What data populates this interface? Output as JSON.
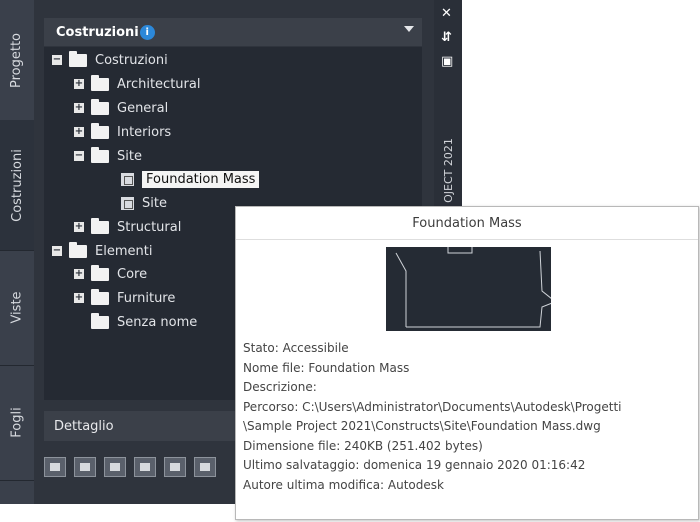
{
  "tabs": {
    "progetto": "Progetto",
    "costruzioni": "Costruzioni",
    "viste": "Viste",
    "fogli": "Fogli"
  },
  "header": {
    "title": "Costruzioni",
    "info": "i"
  },
  "tree": [
    {
      "label": "Costruzioni",
      "expander": "−"
    },
    {
      "label": "Architectural",
      "expander": "+"
    },
    {
      "label": "General",
      "expander": "+"
    },
    {
      "label": "Interiors",
      "expander": "+"
    },
    {
      "label": "Site",
      "expander": "−"
    },
    {
      "label": "Foundation Mass"
    },
    {
      "label": "Site"
    },
    {
      "label": "Structural",
      "expander": "+"
    },
    {
      "label": "Elementi",
      "expander": "−"
    },
    {
      "label": "Core",
      "expander": "+"
    },
    {
      "label": "Furniture",
      "expander": "+"
    },
    {
      "label": "Senza nome"
    }
  ],
  "detail": {
    "label": "Dettaglio"
  },
  "controls": {
    "close": "✕",
    "pin": "⇵",
    "menu": "▣"
  },
  "brand": "OJECT 2021",
  "tooltip": {
    "title": "Foundation Mass",
    "lines": [
      "Stato: Accessibile",
      "Nome file: Foundation Mass",
      "Descrizione:",
      "Percorso: C:\\Users\\Administrator\\Documents\\Autodesk\\Progetti",
      "\\Sample Project 2021\\Constructs\\Site\\Foundation Mass.dwg",
      "Dimensione file: 240KB (251.402 bytes)",
      "Ultimo salvataggio: domenica 19 gennaio 2020  01:16:42",
      "Autore ultima modifica: Autodesk"
    ]
  },
  "colors": {
    "palette_bg": "#2a2f38",
    "tree_bg": "#252a33",
    "accent": "#2c88d9",
    "selection_bg": "#f4f4f4"
  }
}
